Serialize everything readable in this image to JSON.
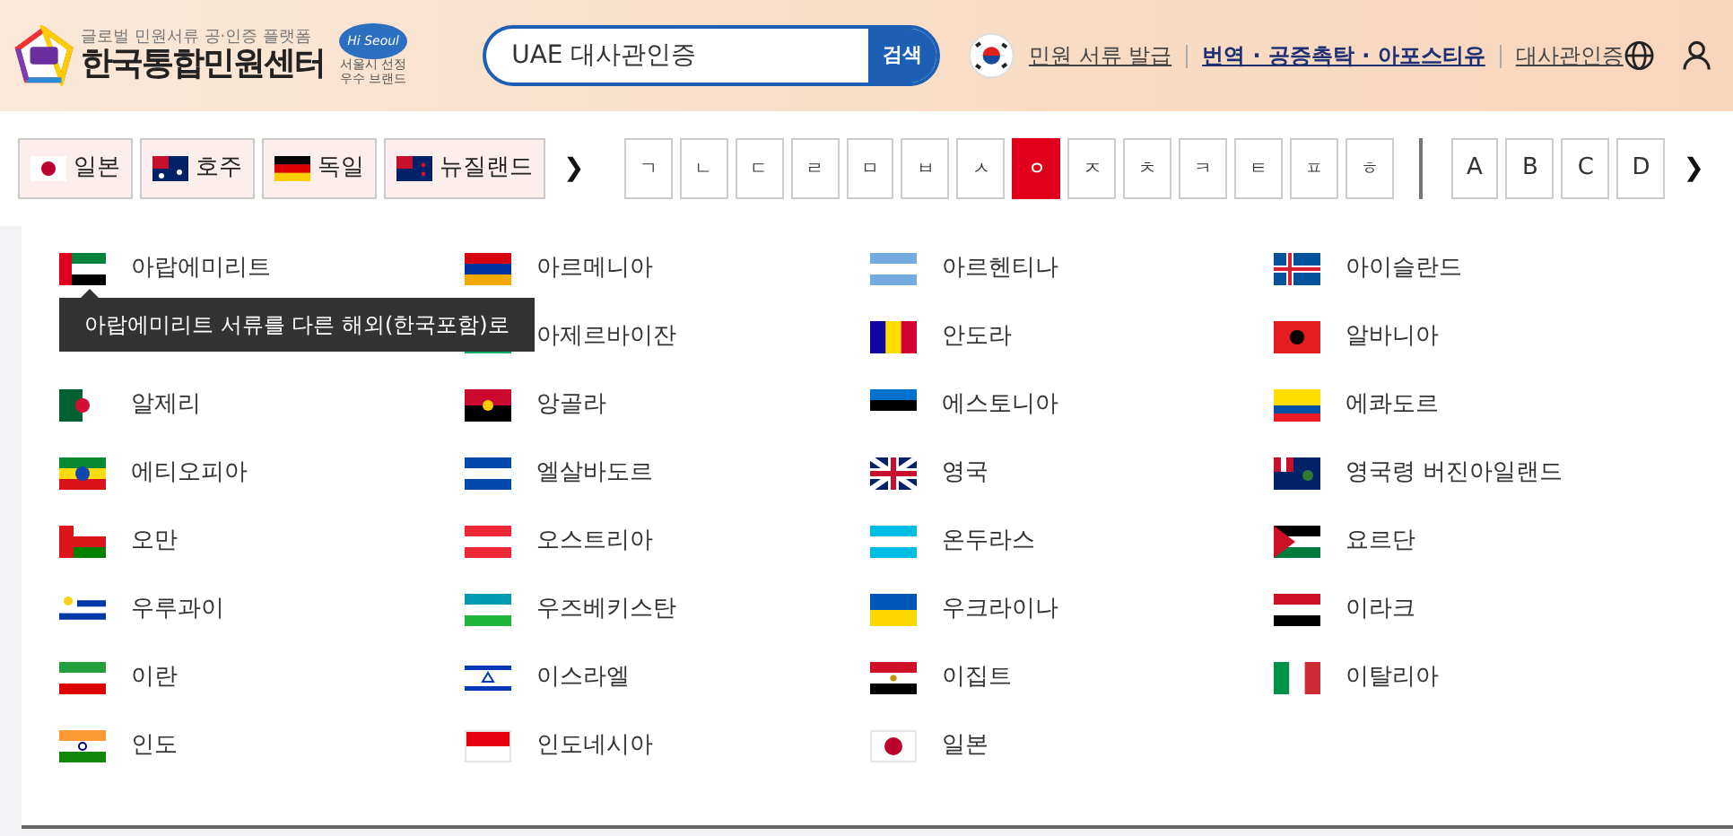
{
  "header": {
    "tagline": "글로벌 민원서류 공·인증 플랫폼",
    "brand": "한국통합민원센터",
    "badge_logo": "Hi Seoul",
    "badge_lines": [
      "서울시 선정",
      "우수 브랜드"
    ]
  },
  "search": {
    "value": "UAE 대사관인증",
    "button": "검색"
  },
  "nav": [
    {
      "text": "민원 서류 발급",
      "bold": false
    },
    {
      "text": "번역 · 공증촉탁 · 아포스티유",
      "bold": true
    },
    {
      "text": "대사관인증",
      "bold": false
    }
  ],
  "favorites": [
    {
      "name": "일본"
    },
    {
      "name": "호주"
    },
    {
      "name": "독일"
    },
    {
      "name": "뉴질랜드"
    }
  ],
  "favorites_next": "❯",
  "consonants": [
    {
      "label": "ㄱ",
      "selected": false
    },
    {
      "label": "ㄴ",
      "selected": false
    },
    {
      "label": "ㄷ",
      "selected": false
    },
    {
      "label": "ㄹ",
      "selected": false
    },
    {
      "label": "ㅁ",
      "selected": false
    },
    {
      "label": "ㅂ",
      "selected": false
    },
    {
      "label": "ㅅ",
      "selected": false
    },
    {
      "label": "ㅇ",
      "selected": true
    },
    {
      "label": "ㅈ",
      "selected": false
    },
    {
      "label": "ㅊ",
      "selected": false
    },
    {
      "label": "ㅋ",
      "selected": false
    },
    {
      "label": "ㅌ",
      "selected": false
    },
    {
      "label": "ㅍ",
      "selected": false
    },
    {
      "label": "ㅎ",
      "selected": false
    }
  ],
  "alphabet": [
    {
      "label": "A",
      "selected": false
    },
    {
      "label": "B",
      "selected": false
    },
    {
      "label": "C",
      "selected": false
    },
    {
      "label": "D",
      "selected": false
    }
  ],
  "letters_next": "❯",
  "tooltip": "아랍에미리트 서류를 다른 해외(한국포함)로",
  "countries": [
    {
      "name": "아랍에미리트"
    },
    {
      "name": "아르메니아"
    },
    {
      "name": "아르헨티나"
    },
    {
      "name": "아이슬란드"
    },
    {
      "name": "아제르바이잔"
    },
    {
      "name": "안도라"
    },
    {
      "name": "알바니아"
    },
    {
      "name": "알제리"
    },
    {
      "name": "앙골라"
    },
    {
      "name": "에스토니아"
    },
    {
      "name": "에콰도르"
    },
    {
      "name": "에티오피아"
    },
    {
      "name": "엘살바도르"
    },
    {
      "name": "영국"
    },
    {
      "name": "영국령 버진아일랜드"
    },
    {
      "name": "오만"
    },
    {
      "name": "오스트리아"
    },
    {
      "name": "온두라스"
    },
    {
      "name": "요르단"
    },
    {
      "name": "우루과이"
    },
    {
      "name": "우즈베키스탄"
    },
    {
      "name": "우크라이나"
    },
    {
      "name": "이라크"
    },
    {
      "name": "이란"
    },
    {
      "name": "이스라엘"
    },
    {
      "name": "이집트"
    },
    {
      "name": "이탈리아"
    },
    {
      "name": "인도"
    },
    {
      "name": "인도네시아"
    },
    {
      "name": "일본"
    }
  ]
}
